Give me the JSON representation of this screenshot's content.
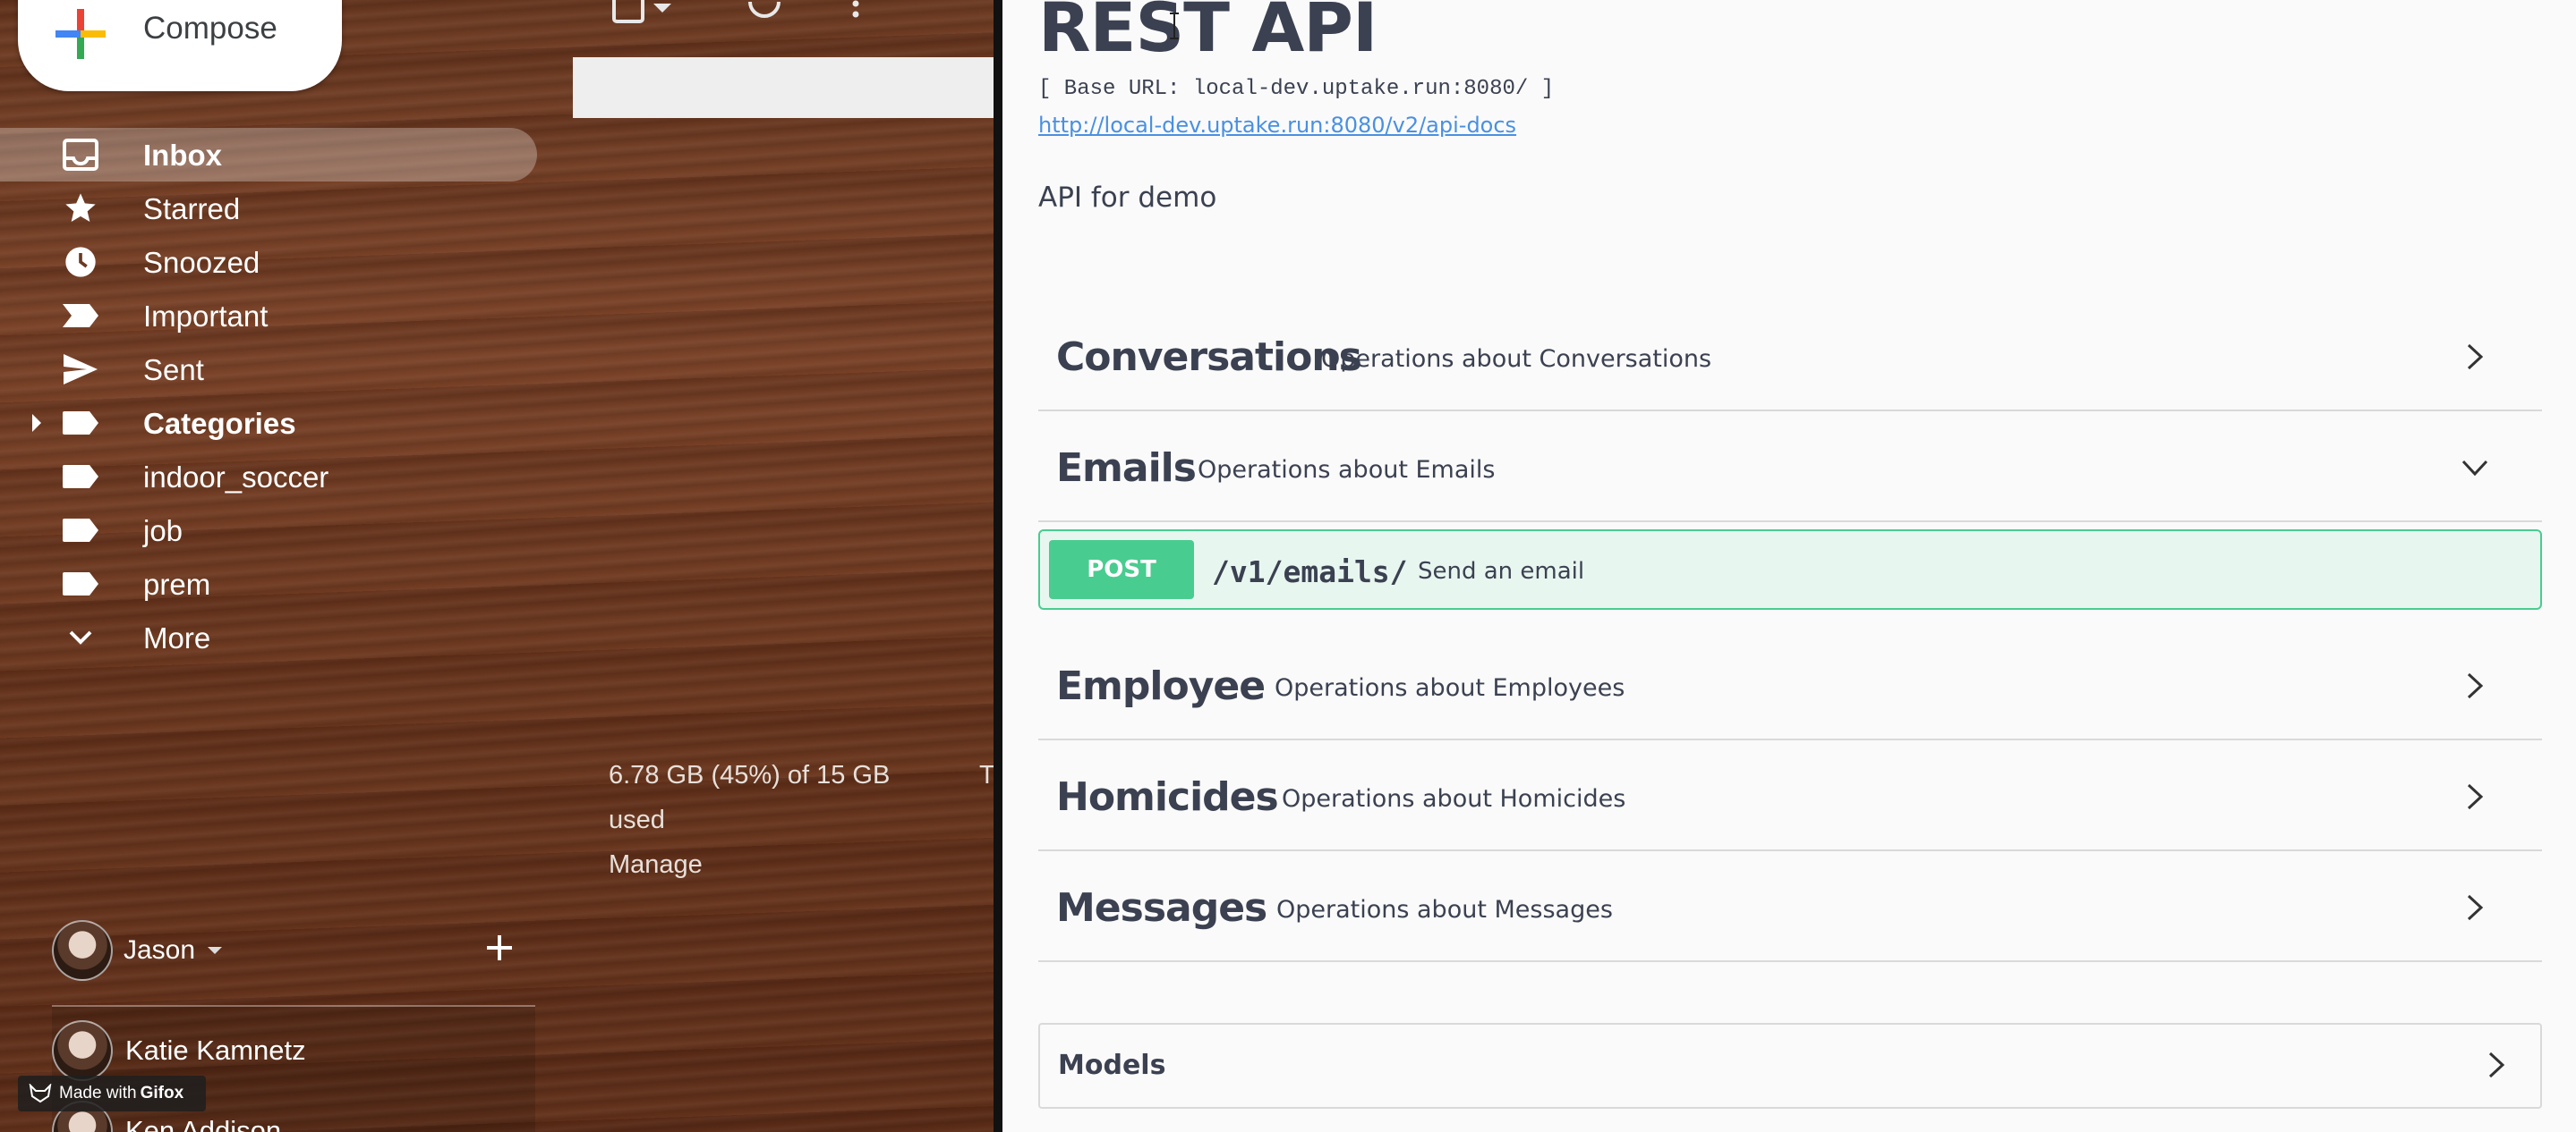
{
  "gmail": {
    "compose_label": "Compose",
    "nav": [
      {
        "label": "Inbox",
        "icon": "inbox-icon",
        "active": true,
        "bold": true
      },
      {
        "label": "Starred",
        "icon": "star-icon"
      },
      {
        "label": "Snoozed",
        "icon": "clock-icon"
      },
      {
        "label": "Important",
        "icon": "important-icon"
      },
      {
        "label": "Sent",
        "icon": "send-icon"
      },
      {
        "label": "Categories",
        "icon": "label-icon",
        "bold": true,
        "expandable": true
      },
      {
        "label": "indoor_soccer",
        "icon": "label-icon"
      },
      {
        "label": "job",
        "icon": "label-icon"
      },
      {
        "label": "prem",
        "icon": "label-icon"
      },
      {
        "label": "More",
        "icon": "chevron-down-icon"
      }
    ],
    "storage": {
      "line1": "6.78 GB (45%) of 15 GB",
      "line2": "used",
      "manage": "Manage",
      "percent": 45
    },
    "storage_trailing": "T",
    "hangouts": {
      "user_name": "Jason",
      "contacts": [
        "Katie Kamnetz",
        "Ken Addison"
      ]
    },
    "gifox_prefix": "Made with ",
    "gifox_brand": "Gifox"
  },
  "swagger": {
    "title": "REST API",
    "base_url": "[ Base URL: local-dev.uptake.run:8080/ ]",
    "api_docs_link": "http://local-dev.uptake.run:8080/v2/api-docs",
    "description": "API for demo",
    "tags": [
      {
        "name": "Conversations",
        "description": "Operations about Conversations",
        "expanded": false
      },
      {
        "name": "Emails",
        "description": "Operations about Emails",
        "expanded": true
      },
      {
        "name": "Employee",
        "description": "Operations about Employees",
        "expanded": false
      },
      {
        "name": "Homicides",
        "description": "Operations about Homicides",
        "expanded": false
      },
      {
        "name": "Messages",
        "description": "Operations about Messages",
        "expanded": false
      }
    ],
    "operation": {
      "method": "POST",
      "path": "/v1/emails/",
      "summary": "Send an email"
    },
    "models_label": "Models"
  },
  "colors": {
    "post_green": "#49cc90",
    "post_bg": "#e8f6f0",
    "swagger_text": "#3b4151",
    "link_blue": "#4990e2"
  }
}
